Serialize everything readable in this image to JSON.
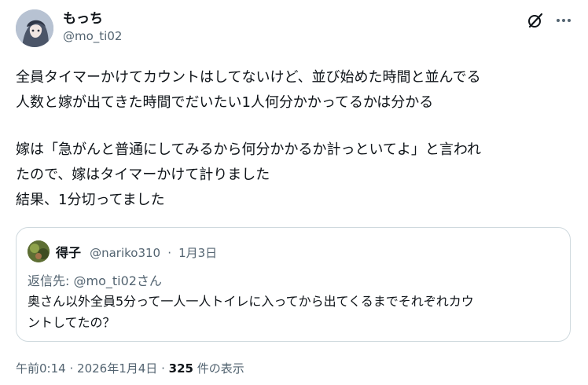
{
  "author": {
    "display_name": "もっち",
    "handle": "@mo_ti02"
  },
  "icons": {
    "grok": "grok-icon",
    "more": "more-dots-icon"
  },
  "tweet": {
    "lines": [
      "全員タイマーかけてカウントはしてないけど、並び始めた時間と並んでる",
      "人数と嫁が出てきた時間でだいたい1人何分かかってるかは分かる",
      "嫁は「急がんと普通にしてみるから何分かかるか計っといてよ」と言われ",
      "たので、嫁はタイマーかけて計りました",
      "結果、1分切ってました"
    ]
  },
  "quote": {
    "display_name": "得子",
    "handle": "@nariko310",
    "separator": "·",
    "date": "1月3日",
    "reply_to": "返信先: @mo_ti02さん",
    "lines": [
      "奥さん以外全員5分って一人一人トイレに入ってから出てくるまでそれぞれカウ",
      "ントしてたの？"
    ]
  },
  "footer": {
    "time": "午前0:14",
    "sep1": "·",
    "date": "2026年1月4日",
    "sep2": "·",
    "views_count": "325",
    "views_label": "件の表示"
  },
  "colors": {
    "text_primary": "#0f1419",
    "text_secondary": "#536471",
    "border": "#cfd9de"
  }
}
